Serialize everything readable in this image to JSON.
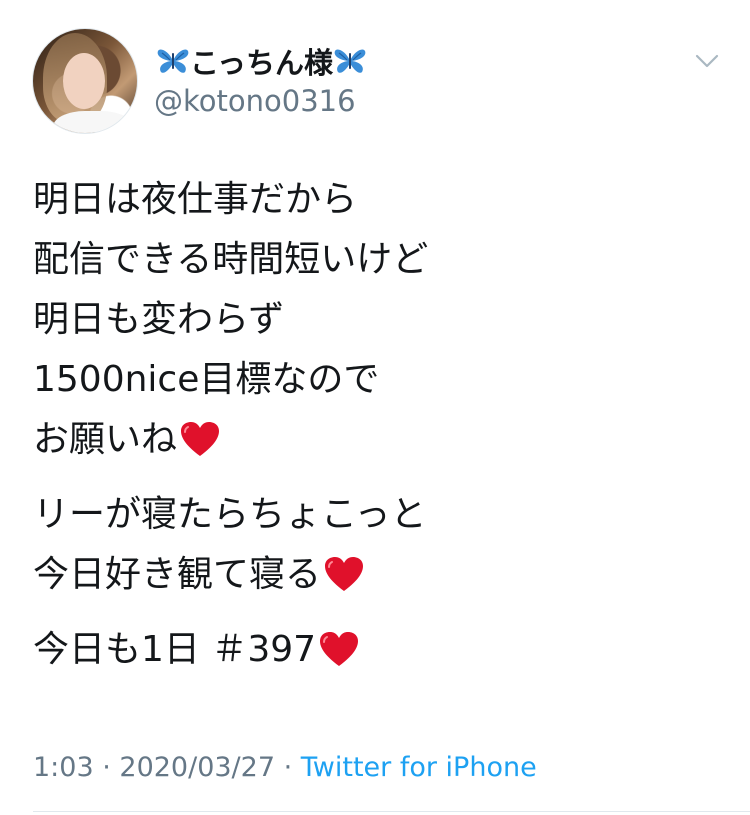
{
  "tweet": {
    "author": {
      "display_name": "こっちん様",
      "prefix_emoji": "butterfly-icon",
      "suffix_emoji": "butterfly-icon",
      "handle": "@kotono0316",
      "avatar": "avatar-image"
    },
    "menu_icon": "chevron-down-icon",
    "body": {
      "paragraph1": {
        "line1": "明日は夜仕事だから",
        "line2": "配信できる時間短いけど",
        "line3": "明日も変わらず",
        "line4": "1500nice目標なので",
        "line5": "お願いね"
      },
      "paragraph2": {
        "line1": "リーが寝たらちょこっと",
        "line2": "今日好き観て寝る"
      },
      "paragraph3": {
        "line1": "今日も1日 ＃397"
      },
      "heart_emoji": "red-heart-icon"
    },
    "meta": {
      "time": "1:03",
      "separator1": " · ",
      "date": "2020/03/27",
      "separator2": " · ",
      "source": "Twitter for iPhone"
    },
    "colors": {
      "text": "#14171a",
      "secondary": "#657786",
      "link": "#1da1f2",
      "butterfly": "#3b8ed8",
      "heart": "#e0112b",
      "divider": "#e1e8ed"
    }
  }
}
